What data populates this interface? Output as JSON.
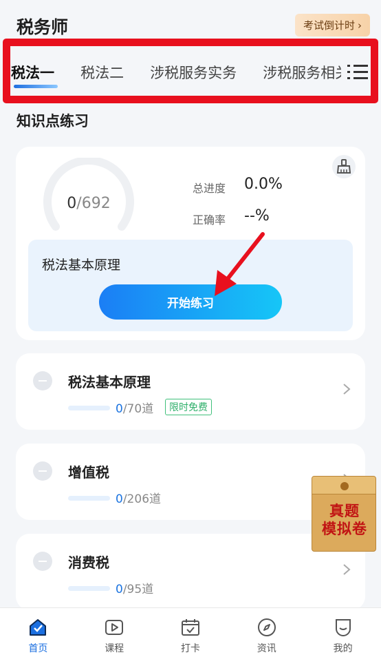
{
  "app": {
    "title": "税务师",
    "countdown_label": "考试倒计时",
    "countdown_chevron": "›"
  },
  "tabs": [
    {
      "label": "税法一",
      "active": true
    },
    {
      "label": "税法二",
      "active": false
    },
    {
      "label": "涉税服务实务",
      "active": false
    },
    {
      "label": "涉税服务相关法律",
      "active": false
    }
  ],
  "section": {
    "title": "知识点练习"
  },
  "practice": {
    "done": "0",
    "separator": "/",
    "total": "692",
    "progress_label": "总进度",
    "progress_value": "0.0%",
    "accuracy_label": "正确率",
    "accuracy_value": "--%",
    "current_topic": "税法基本原理",
    "start_button": "开始练习"
  },
  "chapters": [
    {
      "title": "税法基本原理",
      "done": "0",
      "total": "/70道",
      "badge": "限时免费",
      "progress": 0
    },
    {
      "title": "增值税",
      "done": "0",
      "total": "/206道",
      "badge": "",
      "progress": 0
    },
    {
      "title": "消费税",
      "done": "0",
      "total": "/95道",
      "badge": "",
      "progress": 0
    }
  ],
  "promo": {
    "line1": "真题",
    "line2": "模拟卷"
  },
  "bottom_nav": [
    {
      "label": "首页",
      "icon": "home-icon",
      "active": true
    },
    {
      "label": "课程",
      "icon": "play-icon",
      "active": false
    },
    {
      "label": "打卡",
      "icon": "calendar-check-icon",
      "active": false
    },
    {
      "label": "资讯",
      "icon": "compass-icon",
      "active": false
    },
    {
      "label": "我的",
      "icon": "profile-icon",
      "active": false
    }
  ],
  "colors": {
    "accent": "#1b6fe0",
    "highlight_box": "#e8101e",
    "free_badge": "#2eaf6a",
    "arrow": "#e8101e"
  }
}
